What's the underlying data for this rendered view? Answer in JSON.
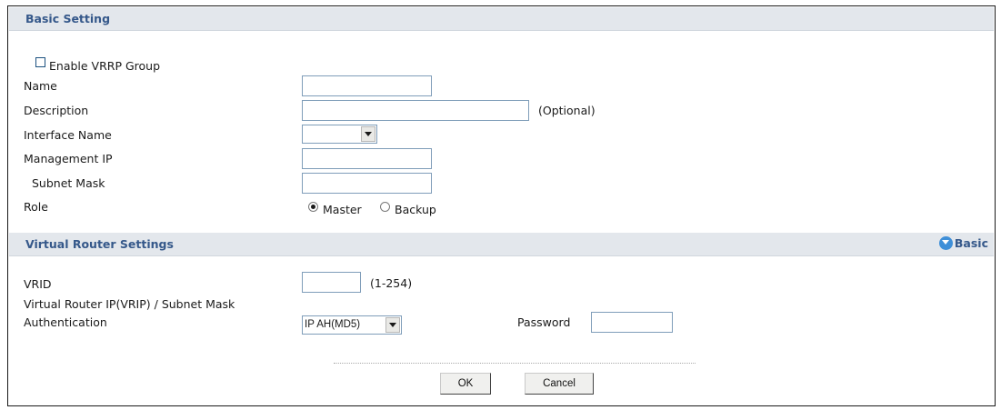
{
  "basic_setting": {
    "title": "Basic Setting",
    "enable_label": "Enable VRRP Group",
    "name_label": "Name",
    "name_value": "",
    "description_label": "Description",
    "description_value": "",
    "optional_hint": "(Optional)",
    "interface_label": "Interface Name",
    "interface_value": "",
    "management_ip_label": "Management IP",
    "management_ip_value": "",
    "subnet_mask_label": "Subnet Mask",
    "subnet_mask_value": "",
    "role_label": "Role",
    "role_master": "Master",
    "role_backup": "Backup",
    "role_selected": "Master"
  },
  "virtual_router": {
    "title": "Virtual Router Settings",
    "basic_link": "Basic",
    "vrid_label": "VRID",
    "vrid_value": "",
    "vrid_hint": "(1-254)",
    "vrip_label": "Virtual Router IP(VRIP) / Subnet Mask",
    "auth_label": "Authentication",
    "auth_value": "IP AH(MD5)",
    "password_label": "Password",
    "password_value": ""
  },
  "buttons": {
    "ok": "OK",
    "cancel": "Cancel"
  },
  "icons": {
    "basic": "collapse-circle-icon"
  },
  "colors": {
    "section_bar": "#e3e7ec",
    "section_title": "#35588a",
    "basic_icon": "#3e8fd8"
  }
}
